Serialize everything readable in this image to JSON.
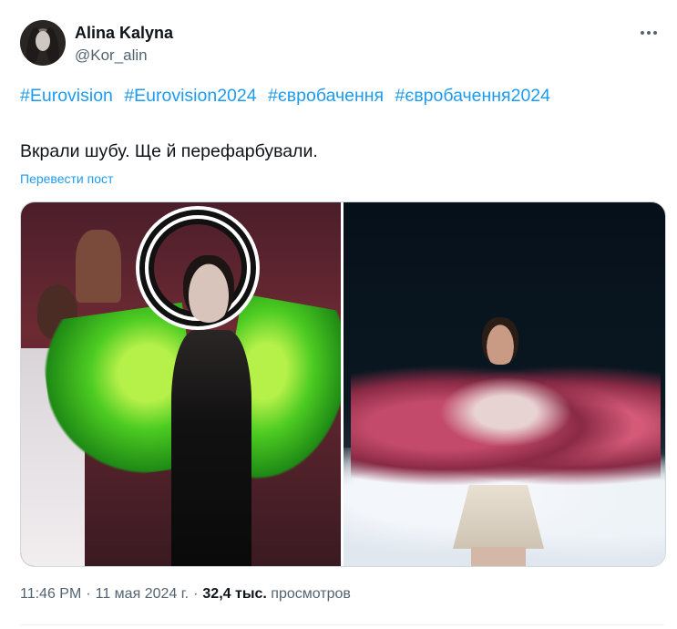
{
  "author": {
    "display_name": "Alina Kalyna",
    "handle": "@Kor_alin"
  },
  "tweet": {
    "hashtags": [
      "#Eurovision",
      "#Eurovision2024",
      "#євробачення",
      "#євробачення2024"
    ],
    "text": "Вкрали шубу. Ще й перефарбували.",
    "translate_label": "Перевести пост"
  },
  "meta": {
    "time": "11:46 PM",
    "date": "11 мая 2024 г.",
    "separator": "·",
    "views_count": "32,4 тыс.",
    "views_label": "просмотров"
  },
  "colors": {
    "accent": "#1d9bf0",
    "text_primary": "#0f1419",
    "text_secondary": "#536471",
    "border": "#cfd9de"
  },
  "icons": {
    "more": "more-horizontal-icon"
  }
}
